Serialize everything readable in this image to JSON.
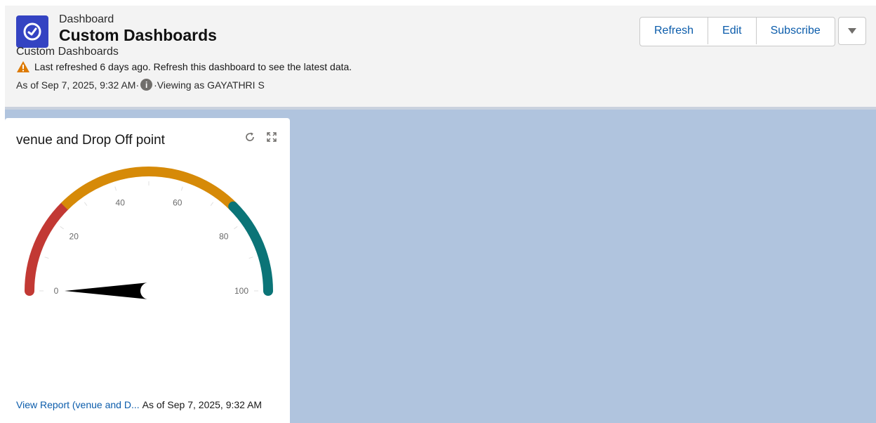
{
  "header": {
    "breadcrumb": "Dashboard",
    "title": "Custom Dashboards",
    "subtitle": "Custom Dashboards",
    "warning": "Last refreshed 6 days ago. Refresh this dashboard to see the latest data.",
    "as_of": "As of Sep 7, 2025, 9:32 AM·",
    "viewing_as": "·Viewing as GAYATHRI S",
    "app_icon": "dashboard-gauge-icon",
    "buttons": {
      "refresh": "Refresh",
      "edit": "Edit",
      "subscribe": "Subscribe"
    }
  },
  "widget": {
    "title": "venue and Drop Off point",
    "gauge": {
      "min": 0,
      "max": 100,
      "value": 0,
      "tick_labels": [
        "0",
        "20",
        "40",
        "60",
        "80",
        "100"
      ],
      "bands": [
        {
          "from": 0,
          "to": 25,
          "color": "#c23934"
        },
        {
          "from": 25,
          "to": 75,
          "color": "#d68a08"
        },
        {
          "from": 75,
          "to": 100,
          "color": "#0b7477"
        }
      ]
    },
    "view_report": "View Report (venue and D...",
    "as_of": "As of Sep 7, 2025, 9:32 AM"
  },
  "colors": {
    "accent": "#0b5cab",
    "app_icon_bg": "#3443c2",
    "canvas_bg": "#b0c4de",
    "warning": "#8c4b02"
  }
}
